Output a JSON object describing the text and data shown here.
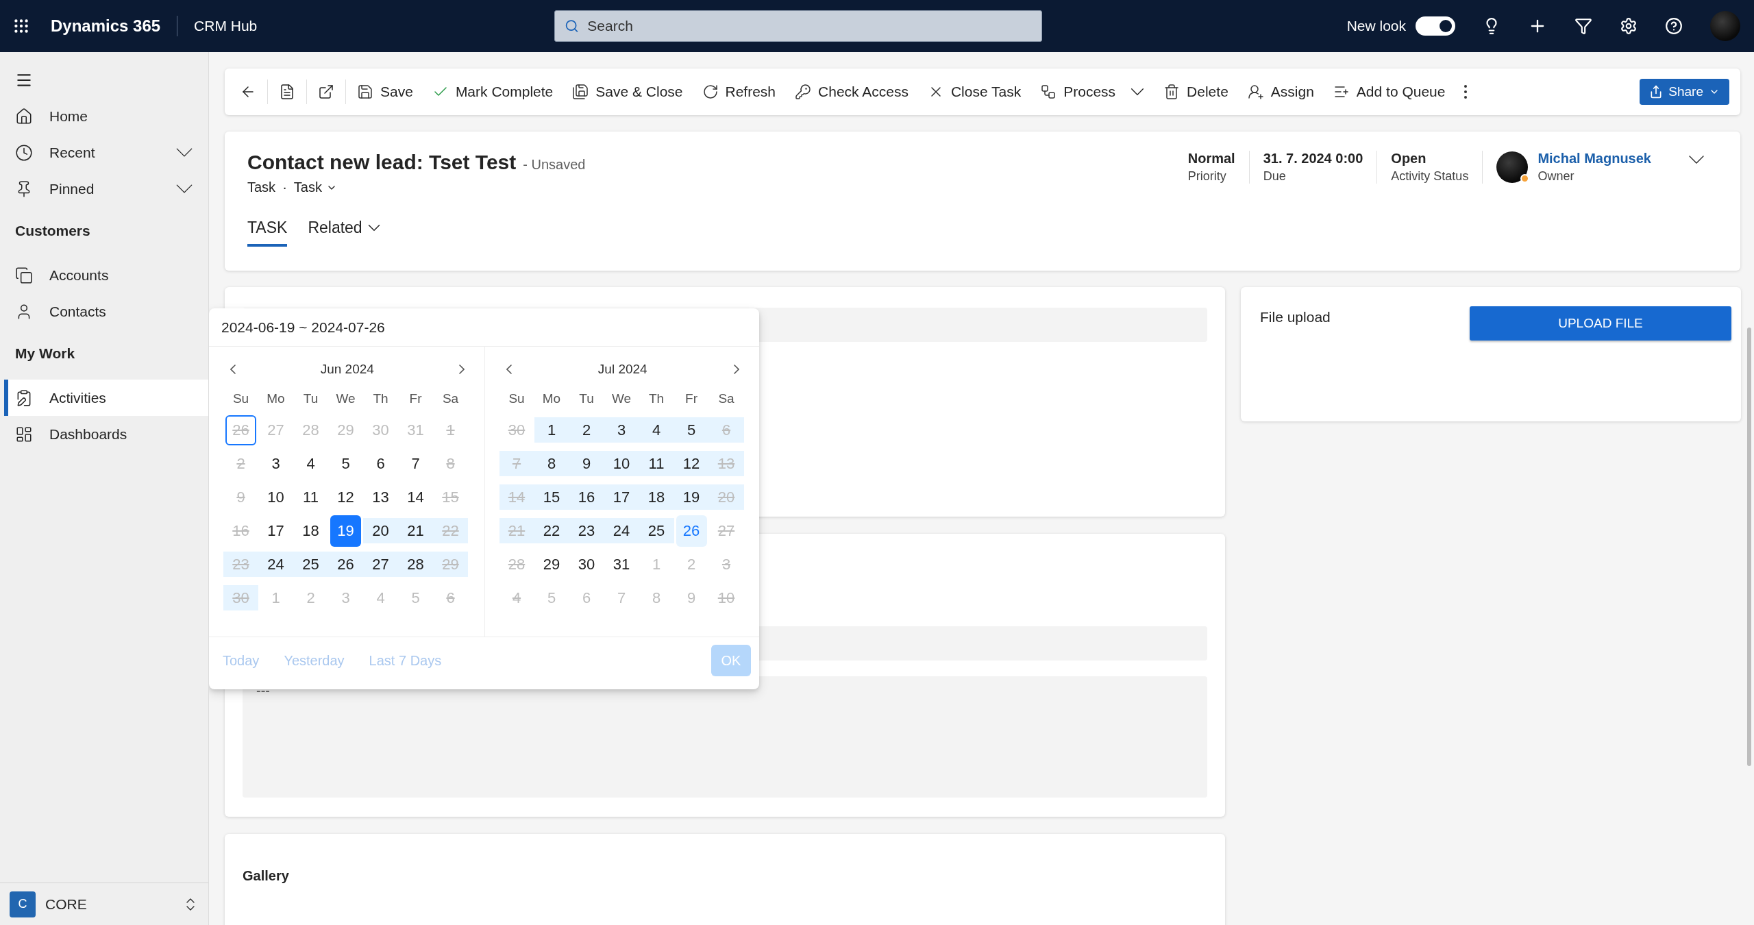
{
  "top_bar": {
    "app_name": "Dynamics 365",
    "area": "CRM Hub",
    "search": {
      "placeholder": "Search"
    },
    "new_look": {
      "label": "New look",
      "on": true
    }
  },
  "sidebar": {
    "top_items": [
      {
        "label": "Home",
        "expandable": false,
        "selected": false
      },
      {
        "label": "Recent",
        "expandable": true,
        "selected": false
      },
      {
        "label": "Pinned",
        "expandable": true,
        "selected": false
      }
    ],
    "sections": [
      {
        "heading": "Customers",
        "items": [
          {
            "label": "Accounts",
            "selected": false
          },
          {
            "label": "Contacts",
            "selected": false
          }
        ]
      },
      {
        "heading": "My Work",
        "items": [
          {
            "label": "Activities",
            "selected": true
          },
          {
            "label": "Dashboards",
            "selected": false
          }
        ]
      }
    ],
    "area_switcher": {
      "badge": "C",
      "label": "CORE"
    }
  },
  "toolbar": {
    "items": [
      {
        "label": "Save",
        "dropdown": false
      },
      {
        "label": "Mark Complete",
        "dropdown": false
      },
      {
        "label": "Save & Close",
        "dropdown": false
      },
      {
        "label": "Refresh",
        "dropdown": false
      },
      {
        "label": "Check Access",
        "dropdown": false
      },
      {
        "label": "Close Task",
        "dropdown": false
      },
      {
        "label": "Process",
        "dropdown": true
      },
      {
        "label": "Delete",
        "dropdown": false
      },
      {
        "label": "Assign",
        "dropdown": false
      },
      {
        "label": "Add to Queue",
        "dropdown": false
      }
    ],
    "share": {
      "label": "Share"
    }
  },
  "header": {
    "title": "Contact new lead: Tset Test",
    "save_state": "- Unsaved",
    "entity": "Task",
    "separator": "·",
    "form": "Task",
    "tabs": [
      {
        "label": "TASK",
        "selected": true,
        "dropdown": false
      },
      {
        "label": "Related",
        "selected": false,
        "dropdown": true
      }
    ],
    "fields": [
      {
        "value": "Normal",
        "label": "Priority"
      },
      {
        "value": "31. 7. 2024 0:00",
        "label": "Due"
      },
      {
        "value": "Open",
        "label": "Activity Status"
      }
    ],
    "owner": {
      "name": "Michal Magnusek",
      "label": "Owner",
      "away": true
    }
  },
  "content": {
    "file_upload": {
      "label": "File upload",
      "button": "UPLOAD FILE"
    },
    "notes": {
      "text": "---"
    },
    "gallery": {
      "title": "Gallery"
    }
  },
  "date_picker": {
    "range": "2024-06-19 ~ 2024-07-26",
    "calendars": [
      {
        "title": "Jun 2024",
        "weekdays": [
          "Su",
          "Mo",
          "Tu",
          "We",
          "Th",
          "Fr",
          "Sa"
        ],
        "days": [
          {
            "label": "26",
            "muted": true,
            "struck": true,
            "in_range": false,
            "selected": false,
            "outlined": true,
            "hovered": false
          },
          {
            "label": "27",
            "muted": true,
            "struck": false,
            "in_range": false,
            "selected": false,
            "outlined": false,
            "hovered": false
          },
          {
            "label": "28",
            "muted": true,
            "struck": false,
            "in_range": false,
            "selected": false,
            "outlined": false,
            "hovered": false
          },
          {
            "label": "29",
            "muted": true,
            "struck": false,
            "in_range": false,
            "selected": false,
            "outlined": false,
            "hovered": false
          },
          {
            "label": "30",
            "muted": true,
            "struck": false,
            "in_range": false,
            "selected": false,
            "outlined": false,
            "hovered": false
          },
          {
            "label": "31",
            "muted": true,
            "struck": false,
            "in_range": false,
            "selected": false,
            "outlined": false,
            "hovered": false
          },
          {
            "label": "1",
            "muted": true,
            "struck": true,
            "in_range": false,
            "selected": false,
            "outlined": false,
            "hovered": false
          },
          {
            "label": "2",
            "muted": true,
            "struck": true,
            "in_range": false,
            "selected": false,
            "outlined": false,
            "hovered": false
          },
          {
            "label": "3",
            "muted": false,
            "struck": false,
            "in_range": false,
            "selected": false,
            "outlined": false,
            "hovered": false
          },
          {
            "label": "4",
            "muted": false,
            "struck": false,
            "in_range": false,
            "selected": false,
            "outlined": false,
            "hovered": false
          },
          {
            "label": "5",
            "muted": false,
            "struck": false,
            "in_range": false,
            "selected": false,
            "outlined": false,
            "hovered": false
          },
          {
            "label": "6",
            "muted": false,
            "struck": false,
            "in_range": false,
            "selected": false,
            "outlined": false,
            "hovered": false
          },
          {
            "label": "7",
            "muted": false,
            "struck": false,
            "in_range": false,
            "selected": false,
            "outlined": false,
            "hovered": false
          },
          {
            "label": "8",
            "muted": true,
            "struck": true,
            "in_range": false,
            "selected": false,
            "outlined": false,
            "hovered": false
          },
          {
            "label": "9",
            "muted": true,
            "struck": true,
            "in_range": false,
            "selected": false,
            "outlined": false,
            "hovered": false
          },
          {
            "label": "10",
            "muted": false,
            "struck": false,
            "in_range": false,
            "selected": false,
            "outlined": false,
            "hovered": false
          },
          {
            "label": "11",
            "muted": false,
            "struck": false,
            "in_range": false,
            "selected": false,
            "outlined": false,
            "hovered": false
          },
          {
            "label": "12",
            "muted": false,
            "struck": false,
            "in_range": false,
            "selected": false,
            "outlined": false,
            "hovered": false
          },
          {
            "label": "13",
            "muted": false,
            "struck": false,
            "in_range": false,
            "selected": false,
            "outlined": false,
            "hovered": false
          },
          {
            "label": "14",
            "muted": false,
            "struck": false,
            "in_range": false,
            "selected": false,
            "outlined": false,
            "hovered": false
          },
          {
            "label": "15",
            "muted": true,
            "struck": true,
            "in_range": false,
            "selected": false,
            "outlined": false,
            "hovered": false
          },
          {
            "label": "16",
            "muted": true,
            "struck": true,
            "in_range": false,
            "selected": false,
            "outlined": false,
            "hovered": false
          },
          {
            "label": "17",
            "muted": false,
            "struck": false,
            "in_range": false,
            "selected": false,
            "outlined": false,
            "hovered": false
          },
          {
            "label": "18",
            "muted": false,
            "struck": false,
            "in_range": false,
            "selected": false,
            "outlined": false,
            "hovered": false
          },
          {
            "label": "19",
            "muted": false,
            "struck": false,
            "in_range": false,
            "selected": true,
            "outlined": false,
            "hovered": false
          },
          {
            "label": "20",
            "muted": false,
            "struck": false,
            "in_range": true,
            "selected": false,
            "outlined": false,
            "hovered": false
          },
          {
            "label": "21",
            "muted": false,
            "struck": false,
            "in_range": true,
            "selected": false,
            "outlined": false,
            "hovered": false
          },
          {
            "label": "22",
            "muted": true,
            "struck": true,
            "in_range": true,
            "selected": false,
            "outlined": false,
            "hovered": false
          },
          {
            "label": "23",
            "muted": true,
            "struck": true,
            "in_range": true,
            "selected": false,
            "outlined": false,
            "hovered": false
          },
          {
            "label": "24",
            "muted": false,
            "struck": false,
            "in_range": true,
            "selected": false,
            "outlined": false,
            "hovered": false
          },
          {
            "label": "25",
            "muted": false,
            "struck": false,
            "in_range": true,
            "selected": false,
            "outlined": false,
            "hovered": false
          },
          {
            "label": "26",
            "muted": false,
            "struck": false,
            "in_range": true,
            "selected": false,
            "outlined": false,
            "hovered": false
          },
          {
            "label": "27",
            "muted": false,
            "struck": false,
            "in_range": true,
            "selected": false,
            "outlined": false,
            "hovered": false
          },
          {
            "label": "28",
            "muted": false,
            "struck": false,
            "in_range": true,
            "selected": false,
            "outlined": false,
            "hovered": false
          },
          {
            "label": "29",
            "muted": true,
            "struck": true,
            "in_range": true,
            "selected": false,
            "outlined": false,
            "hovered": false
          },
          {
            "label": "30",
            "muted": true,
            "struck": true,
            "in_range": true,
            "selected": false,
            "outlined": false,
            "hovered": false
          },
          {
            "label": "1",
            "muted": true,
            "struck": false,
            "in_range": false,
            "selected": false,
            "outlined": false,
            "hovered": false
          },
          {
            "label": "2",
            "muted": true,
            "struck": false,
            "in_range": false,
            "selected": false,
            "outlined": false,
            "hovered": false
          },
          {
            "label": "3",
            "muted": true,
            "struck": false,
            "in_range": false,
            "selected": false,
            "outlined": false,
            "hovered": false
          },
          {
            "label": "4",
            "muted": true,
            "struck": false,
            "in_range": false,
            "selected": false,
            "outlined": false,
            "hovered": false
          },
          {
            "label": "5",
            "muted": true,
            "struck": false,
            "in_range": false,
            "selected": false,
            "outlined": false,
            "hovered": false
          },
          {
            "label": "6",
            "muted": true,
            "struck": true,
            "in_range": false,
            "selected": false,
            "outlined": false,
            "hovered": false
          }
        ]
      },
      {
        "title": "Jul 2024",
        "weekdays": [
          "Su",
          "Mo",
          "Tu",
          "We",
          "Th",
          "Fr",
          "Sa"
        ],
        "days": [
          {
            "label": "30",
            "muted": true,
            "struck": true,
            "in_range": false,
            "selected": false,
            "outlined": false,
            "hovered": false
          },
          {
            "label": "1",
            "muted": false,
            "struck": false,
            "in_range": true,
            "selected": false,
            "outlined": false,
            "hovered": false
          },
          {
            "label": "2",
            "muted": false,
            "struck": false,
            "in_range": true,
            "selected": false,
            "outlined": false,
            "hovered": false
          },
          {
            "label": "3",
            "muted": false,
            "struck": false,
            "in_range": true,
            "selected": false,
            "outlined": false,
            "hovered": false
          },
          {
            "label": "4",
            "muted": false,
            "struck": false,
            "in_range": true,
            "selected": false,
            "outlined": false,
            "hovered": false
          },
          {
            "label": "5",
            "muted": false,
            "struck": false,
            "in_range": true,
            "selected": false,
            "outlined": false,
            "hovered": false
          },
          {
            "label": "6",
            "muted": true,
            "struck": true,
            "in_range": true,
            "selected": false,
            "outlined": false,
            "hovered": false
          },
          {
            "label": "7",
            "muted": true,
            "struck": true,
            "in_range": true,
            "selected": false,
            "outlined": false,
            "hovered": false
          },
          {
            "label": "8",
            "muted": false,
            "struck": false,
            "in_range": true,
            "selected": false,
            "outlined": false,
            "hovered": false
          },
          {
            "label": "9",
            "muted": false,
            "struck": false,
            "in_range": true,
            "selected": false,
            "outlined": false,
            "hovered": false
          },
          {
            "label": "10",
            "muted": false,
            "struck": false,
            "in_range": true,
            "selected": false,
            "outlined": false,
            "hovered": false
          },
          {
            "label": "11",
            "muted": false,
            "struck": false,
            "in_range": true,
            "selected": false,
            "outlined": false,
            "hovered": false
          },
          {
            "label": "12",
            "muted": false,
            "struck": false,
            "in_range": true,
            "selected": false,
            "outlined": false,
            "hovered": false
          },
          {
            "label": "13",
            "muted": true,
            "struck": true,
            "in_range": true,
            "selected": false,
            "outlined": false,
            "hovered": false
          },
          {
            "label": "14",
            "muted": true,
            "struck": true,
            "in_range": true,
            "selected": false,
            "outlined": false,
            "hovered": false
          },
          {
            "label": "15",
            "muted": false,
            "struck": false,
            "in_range": true,
            "selected": false,
            "outlined": false,
            "hovered": false
          },
          {
            "label": "16",
            "muted": false,
            "struck": false,
            "in_range": true,
            "selected": false,
            "outlined": false,
            "hovered": false
          },
          {
            "label": "17",
            "muted": false,
            "struck": false,
            "in_range": true,
            "selected": false,
            "outlined": false,
            "hovered": false
          },
          {
            "label": "18",
            "muted": false,
            "struck": false,
            "in_range": true,
            "selected": false,
            "outlined": false,
            "hovered": false
          },
          {
            "label": "19",
            "muted": false,
            "struck": false,
            "in_range": true,
            "selected": false,
            "outlined": false,
            "hovered": false
          },
          {
            "label": "20",
            "muted": true,
            "struck": true,
            "in_range": true,
            "selected": false,
            "outlined": false,
            "hovered": false
          },
          {
            "label": "21",
            "muted": true,
            "struck": true,
            "in_range": true,
            "selected": false,
            "outlined": false,
            "hovered": false
          },
          {
            "label": "22",
            "muted": false,
            "struck": false,
            "in_range": true,
            "selected": false,
            "outlined": false,
            "hovered": false
          },
          {
            "label": "23",
            "muted": false,
            "struck": false,
            "in_range": true,
            "selected": false,
            "outlined": false,
            "hovered": false
          },
          {
            "label": "24",
            "muted": false,
            "struck": false,
            "in_range": true,
            "selected": false,
            "outlined": false,
            "hovered": false
          },
          {
            "label": "25",
            "muted": false,
            "struck": false,
            "in_range": true,
            "selected": false,
            "outlined": false,
            "hovered": false
          },
          {
            "label": "26",
            "muted": false,
            "struck": false,
            "in_range": false,
            "selected": false,
            "outlined": false,
            "hovered": true
          },
          {
            "label": "27",
            "muted": true,
            "struck": true,
            "in_range": false,
            "selected": false,
            "outlined": false,
            "hovered": false
          },
          {
            "label": "28",
            "muted": true,
            "struck": true,
            "in_range": false,
            "selected": false,
            "outlined": false,
            "hovered": false
          },
          {
            "label": "29",
            "muted": false,
            "struck": false,
            "in_range": false,
            "selected": false,
            "outlined": false,
            "hovered": false
          },
          {
            "label": "30",
            "muted": false,
            "struck": false,
            "in_range": false,
            "selected": false,
            "outlined": false,
            "hovered": false
          },
          {
            "label": "31",
            "muted": false,
            "struck": false,
            "in_range": false,
            "selected": false,
            "outlined": false,
            "hovered": false
          },
          {
            "label": "1",
            "muted": true,
            "struck": false,
            "in_range": false,
            "selected": false,
            "outlined": false,
            "hovered": false
          },
          {
            "label": "2",
            "muted": true,
            "struck": false,
            "in_range": false,
            "selected": false,
            "outlined": false,
            "hovered": false
          },
          {
            "label": "3",
            "muted": true,
            "struck": true,
            "in_range": false,
            "selected": false,
            "outlined": false,
            "hovered": false
          },
          {
            "label": "4",
            "muted": true,
            "struck": true,
            "in_range": false,
            "selected": false,
            "outlined": false,
            "hovered": false
          },
          {
            "label": "5",
            "muted": true,
            "struck": false,
            "in_range": false,
            "selected": false,
            "outlined": false,
            "hovered": false
          },
          {
            "label": "6",
            "muted": true,
            "struck": false,
            "in_range": false,
            "selected": false,
            "outlined": false,
            "hovered": false
          },
          {
            "label": "7",
            "muted": true,
            "struck": false,
            "in_range": false,
            "selected": false,
            "outlined": false,
            "hovered": false
          },
          {
            "label": "8",
            "muted": true,
            "struck": false,
            "in_range": false,
            "selected": false,
            "outlined": false,
            "hovered": false
          },
          {
            "label": "9",
            "muted": true,
            "struck": false,
            "in_range": false,
            "selected": false,
            "outlined": false,
            "hovered": false
          },
          {
            "label": "10",
            "muted": true,
            "struck": true,
            "in_range": false,
            "selected": false,
            "outlined": false,
            "hovered": false
          }
        ]
      }
    ],
    "shortcuts": [
      "Today",
      "Yesterday",
      "Last 7 Days"
    ],
    "ok": {
      "label": "OK",
      "disabled": true
    }
  }
}
